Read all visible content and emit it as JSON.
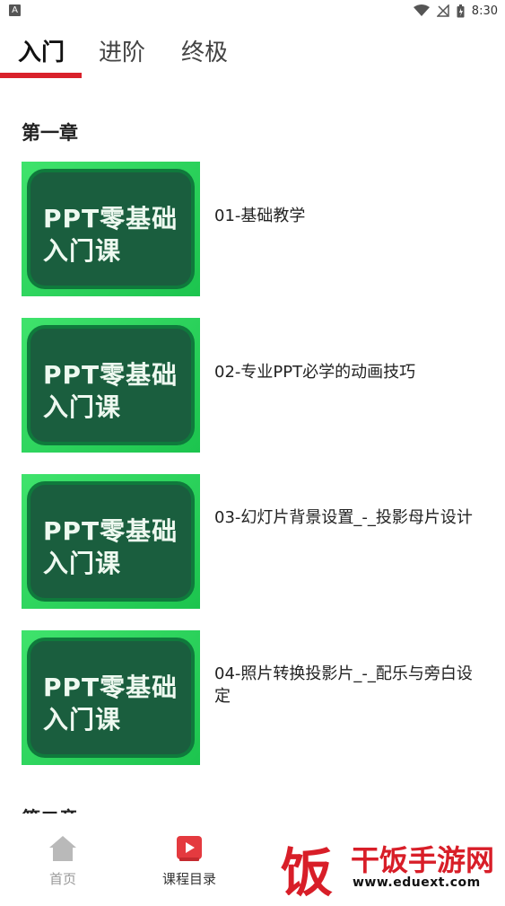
{
  "status_bar": {
    "time": "8:30",
    "app_letter": "A"
  },
  "tabs": [
    {
      "label": "入门",
      "active": true
    },
    {
      "label": "进阶",
      "active": false
    },
    {
      "label": "终极",
      "active": false
    }
  ],
  "chapters": [
    {
      "title": "第一章"
    },
    {
      "title": "第二章"
    }
  ],
  "thumbnail": {
    "line1": "PPT零基础",
    "line2": "入门课"
  },
  "lessons": [
    {
      "title": "01-基础教学"
    },
    {
      "title": "02-专业PPT必学的动画技巧"
    },
    {
      "title": "03-幻灯片背景设置_-_投影母片设计"
    },
    {
      "title": "04-照片转换投影片_-_配乐与旁白设定"
    }
  ],
  "bottom_nav": [
    {
      "label": "首页",
      "icon": "home-icon",
      "active": false
    },
    {
      "label": "课程目录",
      "icon": "play-icon",
      "active": true
    }
  ],
  "watermark": {
    "name": "干饭手游网",
    "url": "www.eduext.com",
    "char": "饭"
  },
  "colors": {
    "accent": "#d9212b",
    "thumb_green": "#1cc44e",
    "thumb_dark": "#1a5e3e"
  }
}
